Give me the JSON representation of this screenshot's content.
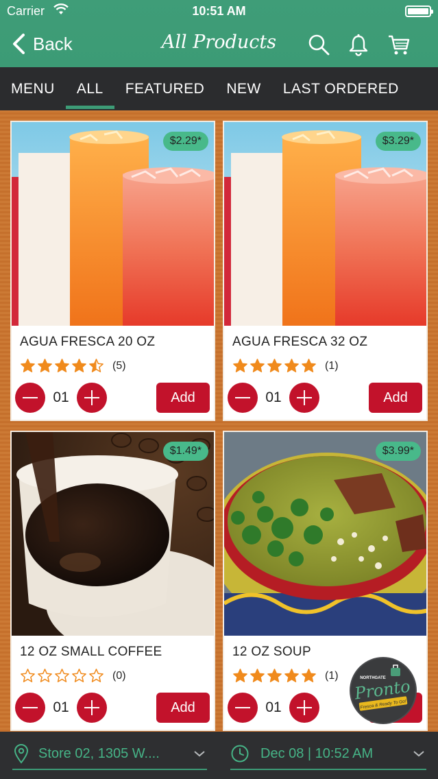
{
  "status_bar": {
    "carrier": "Carrier",
    "time": "10:51 AM"
  },
  "nav": {
    "back_label": "Back",
    "title": "All Products"
  },
  "tabs": [
    {
      "label": "MENU"
    },
    {
      "label": "ALL",
      "active": true
    },
    {
      "label": "FEATURED"
    },
    {
      "label": "NEW"
    },
    {
      "label": "LAST ORDERED"
    }
  ],
  "products": [
    {
      "name": "AGUA FRESCA 20 OZ",
      "price": "$2.29*",
      "rating": 4.5,
      "rating_count": "(5)",
      "quantity": "01",
      "add_label": "Add",
      "image": "agua-fresca"
    },
    {
      "name": "AGUA FRESCA 32 OZ",
      "price": "$3.29*",
      "rating": 5,
      "rating_count": "(1)",
      "quantity": "01",
      "add_label": "Add",
      "image": "agua-fresca"
    },
    {
      "name": "12 OZ SMALL COFFEE",
      "price": "$1.49*",
      "rating": 0,
      "rating_count": "(0)",
      "quantity": "01",
      "add_label": "Add",
      "image": "coffee"
    },
    {
      "name": "12 OZ SOUP",
      "price": "$3.99*",
      "rating": 5,
      "rating_count": "(1)",
      "quantity": "01",
      "add_label": "Add",
      "image": "soup"
    }
  ],
  "badge": {
    "top": "NORTHGATE",
    "brand": "Pronto",
    "tagline": "Fresca & Ready To Go!"
  },
  "bottom_bar": {
    "store": "Store 02, 1305 W....",
    "datetime": "Dec 08 | 10:52 AM"
  },
  "colors": {
    "nav_green": "#3d9c77",
    "accent_red": "#c2122b",
    "price_green": "#48b98a",
    "star_orange": "#f08a1c"
  }
}
